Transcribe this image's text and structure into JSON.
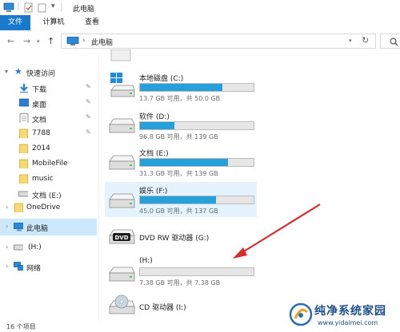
{
  "window": {
    "title": "此电脑"
  },
  "ribbon": {
    "tabs": [
      {
        "label": "文件"
      },
      {
        "label": "计算机"
      },
      {
        "label": "查看"
      }
    ]
  },
  "address": {
    "path": "此电脑",
    "separator": "›"
  },
  "sidebar": {
    "quick_access": "快速访问",
    "items": [
      {
        "label": "下载",
        "icon": "download-icon"
      },
      {
        "label": "桌面",
        "icon": "desktop-folder-icon"
      },
      {
        "label": "文档",
        "icon": "document-icon"
      },
      {
        "label": "7788",
        "icon": "folder-icon"
      },
      {
        "label": "2014",
        "icon": "folder-icon"
      },
      {
        "label": "MobileFile",
        "icon": "folder-icon"
      },
      {
        "label": "music",
        "icon": "folder-icon"
      },
      {
        "label": "文档 (E:)",
        "icon": "drive-icon"
      }
    ],
    "onedrive": "OneDrive",
    "this_pc": "此电脑",
    "h_drive": "(H:)",
    "network": "网络"
  },
  "drives": [
    {
      "name": "本地磁盘 (C:)",
      "free": "13.7 GB 可用，共 50.0 GB",
      "used_fraction": 0.726
    },
    {
      "name": "软件 (D:)",
      "free": "96.8 GB 可用，共 139 GB",
      "used_fraction": 0.304
    },
    {
      "name": "文档 (E:)",
      "free": "31.3 GB 可用，共 139 GB",
      "used_fraction": 0.775
    },
    {
      "name": "娱乐 (F:)",
      "free": "45.0 GB 可用，共 137 GB",
      "used_fraction": 0.672
    },
    {
      "name": "DVD RW 驱动器 (G:)"
    },
    {
      "name": "(H:)",
      "free": "7.38 GB 可用，共 7.38 GB",
      "used_fraction": 0.0
    },
    {
      "name": "CD 驱动器 (I:)"
    }
  ],
  "status": {
    "items": "16 个项目"
  },
  "watermark": {
    "line1": "纯净系统家园",
    "line2": "www.yidaimei.com"
  },
  "colors": {
    "accent": "#1979ca",
    "bar_fill": "#26a0da",
    "selected": "#cce8ff",
    "arrow": "#d62d2d"
  }
}
